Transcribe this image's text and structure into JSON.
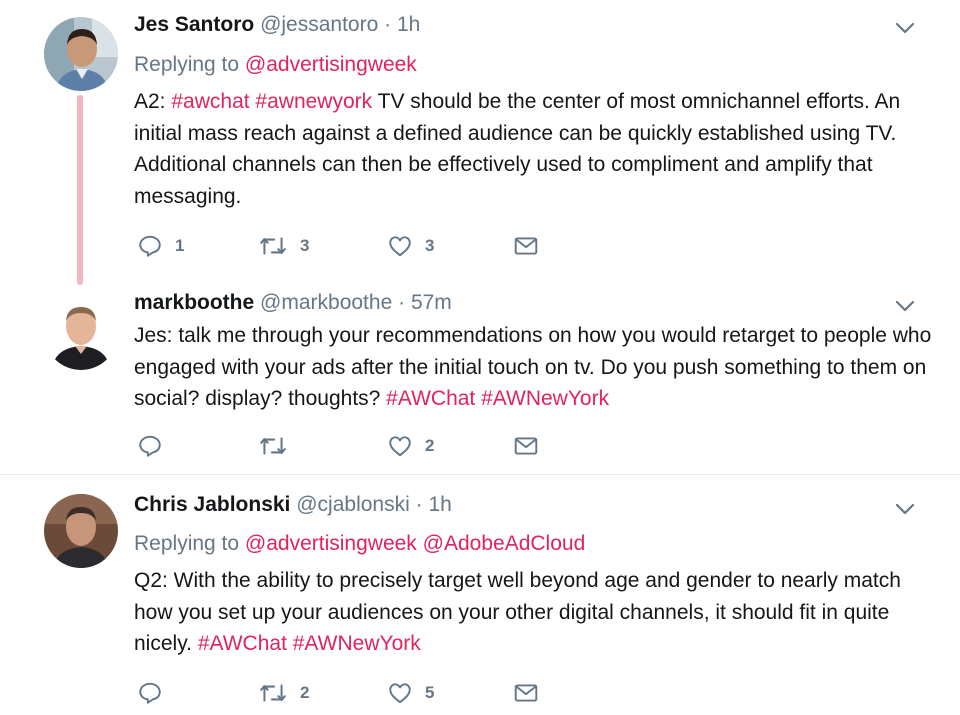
{
  "colors": {
    "link": "#e0245e",
    "muted": "#657786",
    "text": "#14171a",
    "thread_line": "#f3b5bf",
    "divider": "#e6ecf0"
  },
  "tweets": [
    {
      "name": "Jes Santoro",
      "handle": "@jessantoro",
      "sep": "·",
      "time": "1h",
      "replying_label": "Replying to",
      "replying_to": [
        "@advertisingweek"
      ],
      "body_segments": [
        {
          "text": "A2: ",
          "kind": "text"
        },
        {
          "text": "#awchat",
          "kind": "link"
        },
        {
          "text": " ",
          "kind": "text"
        },
        {
          "text": "#awnewyork",
          "kind": "link"
        },
        {
          "text": " TV should be the center of most omnichannel efforts. An initial mass reach against a defined audience can be quickly established using TV.  Additional channels can then be effectively used to compliment and amplify that messaging.",
          "kind": "text"
        }
      ],
      "reply_count": "1",
      "retweet_count": "3",
      "like_count": "3",
      "avatar_icon": "avatar-jes-santoro"
    },
    {
      "name": "markboothe",
      "handle": "@markboothe",
      "sep": "·",
      "time": "57m",
      "body_segments": [
        {
          "text": "Jes: talk me through your recommendations on how you would retarget to people who engaged with your ads after the initial touch on tv. Do you push something to them on social? display? thoughts? ",
          "kind": "text"
        },
        {
          "text": "#AWChat",
          "kind": "link"
        },
        {
          "text": " ",
          "kind": "text"
        },
        {
          "text": "#AWNewYork",
          "kind": "link"
        }
      ],
      "reply_count": "",
      "retweet_count": "",
      "like_count": "2",
      "avatar_icon": "avatar-markboothe"
    },
    {
      "name": "Chris Jablonski",
      "handle": "@cjablonski",
      "sep": "·",
      "time": "1h",
      "replying_label": "Replying to",
      "replying_to": [
        "@advertisingweek",
        "@AdobeAdCloud"
      ],
      "body_segments": [
        {
          "text": "Q2: With the ability to precisely target well beyond age and gender to nearly match how you set up your audiences on your other digital channels, it should fit in quite nicely. ",
          "kind": "text"
        },
        {
          "text": "#AWChat",
          "kind": "link"
        },
        {
          "text": " ",
          "kind": "text"
        },
        {
          "text": "#AWNewYork",
          "kind": "link"
        }
      ],
      "reply_count": "",
      "retweet_count": "2",
      "like_count": "5",
      "avatar_icon": "avatar-chris-jablonski"
    }
  ]
}
